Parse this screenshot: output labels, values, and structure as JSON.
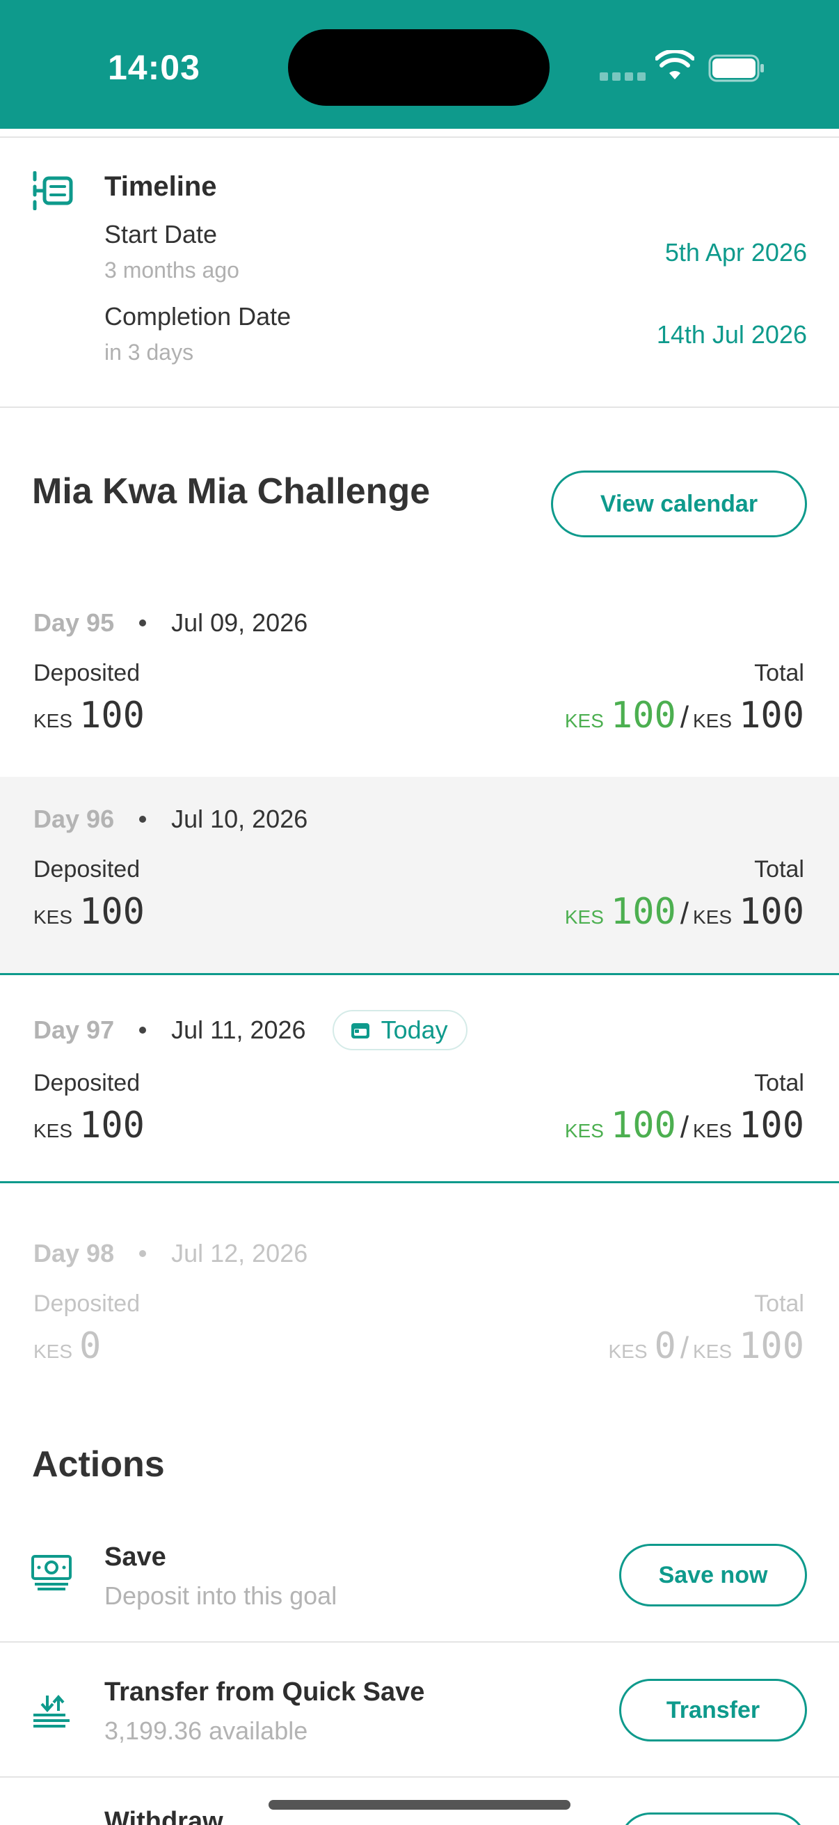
{
  "status_bar": {
    "time": "14:03"
  },
  "timeline": {
    "title": "Timeline",
    "start_label": "Start Date",
    "start_relative": "3 months ago",
    "start_date": "5th Apr 2026",
    "completion_label": "Completion Date",
    "completion_relative": "in 3 days",
    "completion_date": "14th Jul 2026"
  },
  "challenge": {
    "title": "Mia Kwa Mia Challenge",
    "view_calendar_label": "View calendar",
    "deposited_label": "Deposited",
    "total_label": "Total",
    "currency": "KES",
    "today_badge": "Today",
    "days": [
      {
        "day": "Day 95",
        "date": "Jul 09, 2026",
        "deposited": "100",
        "total_saved": "100",
        "total_target": "100"
      },
      {
        "day": "Day 96",
        "date": "Jul 10, 2026",
        "deposited": "100",
        "total_saved": "100",
        "total_target": "100"
      },
      {
        "day": "Day 97",
        "date": "Jul 11, 2026",
        "deposited": "100",
        "total_saved": "100",
        "total_target": "100"
      },
      {
        "day": "Day 98",
        "date": "Jul 12, 2026",
        "deposited": "0",
        "total_saved": "0",
        "total_target": "100"
      }
    ]
  },
  "actions": {
    "title": "Actions",
    "items": [
      {
        "name": "Save",
        "subtitle": "Deposit into this goal",
        "button": "Save now",
        "icon": "cash-icon"
      },
      {
        "name": "Transfer from Quick Save",
        "subtitle": "3,199.36 available",
        "button": "Transfer",
        "icon": "transfer-icon"
      },
      {
        "name": "Withdraw",
        "icon": "withdraw-icon"
      }
    ]
  },
  "colors": {
    "brand": "#0e9a8c",
    "deposit_green": "#4caf50",
    "muted": "#b3b3b3"
  }
}
